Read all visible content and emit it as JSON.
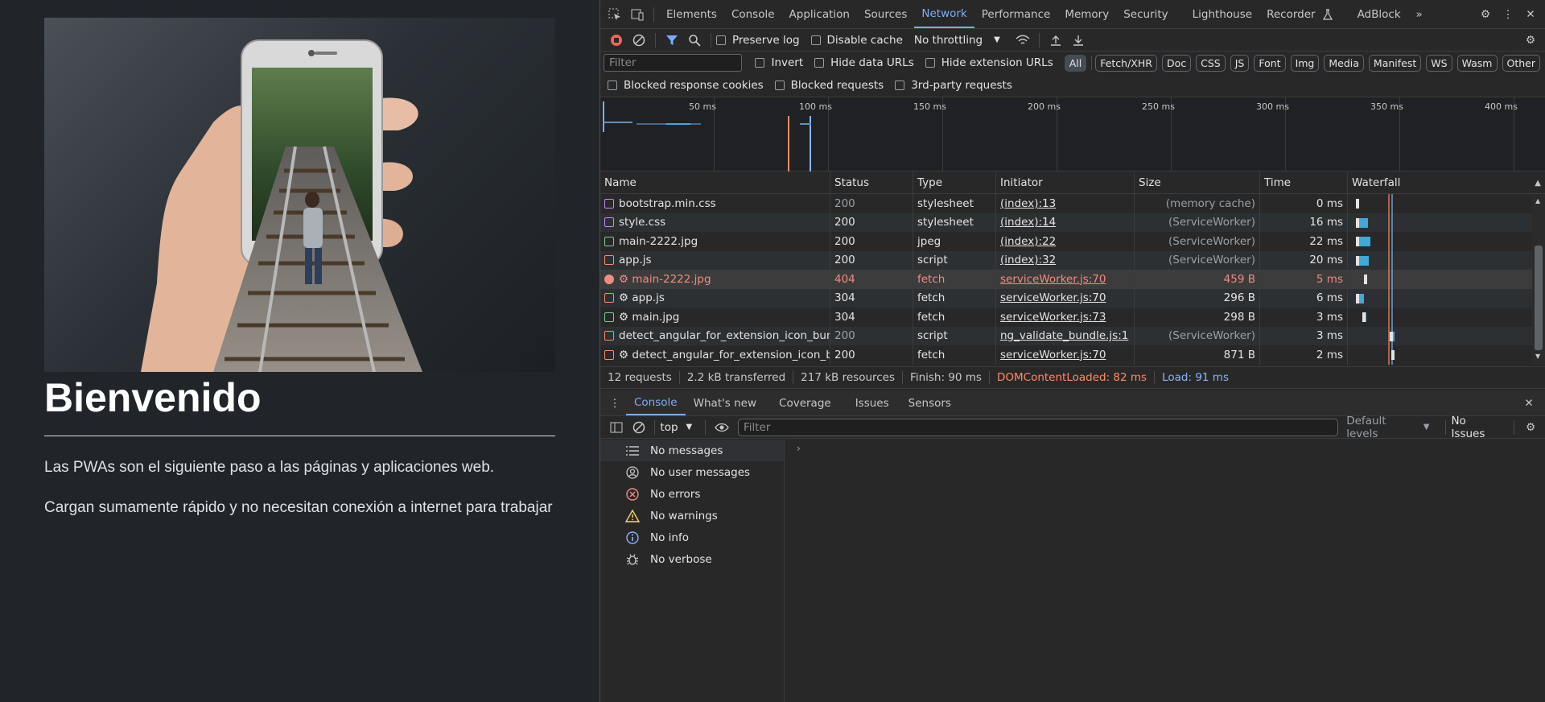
{
  "page": {
    "title": "Bienvenido",
    "paragraph1": "Las PWAs son el siguiente paso a las páginas y aplicaciones web.",
    "paragraph2": "Cargan sumamente rápido y no necesitan conexión a internet para trabajar"
  },
  "devtools": {
    "tabs": [
      "Elements",
      "Console",
      "Application",
      "Sources",
      "Network",
      "Performance",
      "Memory",
      "Security",
      "Lighthouse",
      "Recorder",
      "AdBlock"
    ],
    "active_tab": "Network",
    "toolbar": {
      "preserve_log": "Preserve log",
      "disable_cache": "Disable cache",
      "throttling": "No throttling"
    },
    "filter_row": {
      "placeholder": "Filter",
      "invert": "Invert",
      "hide_data_urls": "Hide data URLs",
      "hide_extension_urls": "Hide extension URLs",
      "chips": [
        "All",
        "Fetch/XHR",
        "Doc",
        "CSS",
        "JS",
        "Font",
        "Img",
        "Media",
        "Manifest",
        "WS",
        "Wasm",
        "Other"
      ]
    },
    "blocked_row": {
      "blocked_cookies": "Blocked response cookies",
      "blocked_requests": "Blocked requests",
      "third_party": "3rd-party requests"
    },
    "timeline_labels": [
      "50 ms",
      "100 ms",
      "150 ms",
      "200 ms",
      "250 ms",
      "300 ms",
      "350 ms",
      "400 ms"
    ],
    "columns": [
      "Name",
      "Status",
      "Type",
      "Initiator",
      "Size",
      "Time",
      "Waterfall"
    ],
    "rows": [
      {
        "name": "bootstrap.min.css",
        "status": "200",
        "type": "stylesheet",
        "initiator": "(index):13",
        "size": "(memory cache)",
        "time": "0 ms",
        "kind": "css"
      },
      {
        "name": "style.css",
        "status": "200",
        "type": "stylesheet",
        "initiator": "(index):14",
        "size": "(ServiceWorker)",
        "time": "16 ms",
        "kind": "css"
      },
      {
        "name": "main-2222.jpg",
        "status": "200",
        "type": "jpeg",
        "initiator": "(index):22",
        "size": "(ServiceWorker)",
        "time": "22 ms",
        "kind": "img"
      },
      {
        "name": "app.js",
        "status": "200",
        "type": "script",
        "initiator": "(index):32",
        "size": "(ServiceWorker)",
        "time": "20 ms",
        "kind": "js"
      },
      {
        "name": "⚙ main-2222.jpg",
        "status": "404",
        "type": "fetch",
        "initiator": "serviceWorker.js:70",
        "size": "459 B",
        "time": "5 ms",
        "kind": "err"
      },
      {
        "name": "⚙ app.js",
        "status": "304",
        "type": "fetch",
        "initiator": "serviceWorker.js:70",
        "size": "296 B",
        "time": "6 ms",
        "kind": "js"
      },
      {
        "name": "⚙ main.jpg",
        "status": "304",
        "type": "fetch",
        "initiator": "serviceWorker.js:73",
        "size": "298 B",
        "time": "3 ms",
        "kind": "img"
      },
      {
        "name": "detect_angular_for_extension_icon_bundl...",
        "status": "200",
        "type": "script",
        "initiator": "ng_validate_bundle.js:1",
        "size": "(ServiceWorker)",
        "time": "3 ms",
        "kind": "js"
      },
      {
        "name": "⚙ detect_angular_for_extension_icon_bu...",
        "status": "200",
        "type": "fetch",
        "initiator": "serviceWorker.js:70",
        "size": "871 B",
        "time": "2 ms",
        "kind": "js"
      }
    ],
    "summary": {
      "requests": "12 requests",
      "transferred": "2.2 kB transferred",
      "resources": "217 kB resources",
      "finish": "Finish: 90 ms",
      "dcl": "DOMContentLoaded: 82 ms",
      "load": "Load: 91 ms"
    },
    "drawer_tabs": [
      "Console",
      "What's new",
      "Coverage",
      "Issues",
      "Sensors"
    ],
    "console": {
      "context": "top",
      "filter_placeholder": "Filter",
      "levels": "Default levels",
      "issues": "No Issues",
      "sidebar": [
        "No messages",
        "No user messages",
        "No errors",
        "No warnings",
        "No info",
        "No verbose"
      ]
    },
    "colors": {
      "accent": "#7cacf8",
      "error": "#f28b82",
      "dcl": "#ff8a65",
      "load": "#8ab4f8"
    }
  }
}
